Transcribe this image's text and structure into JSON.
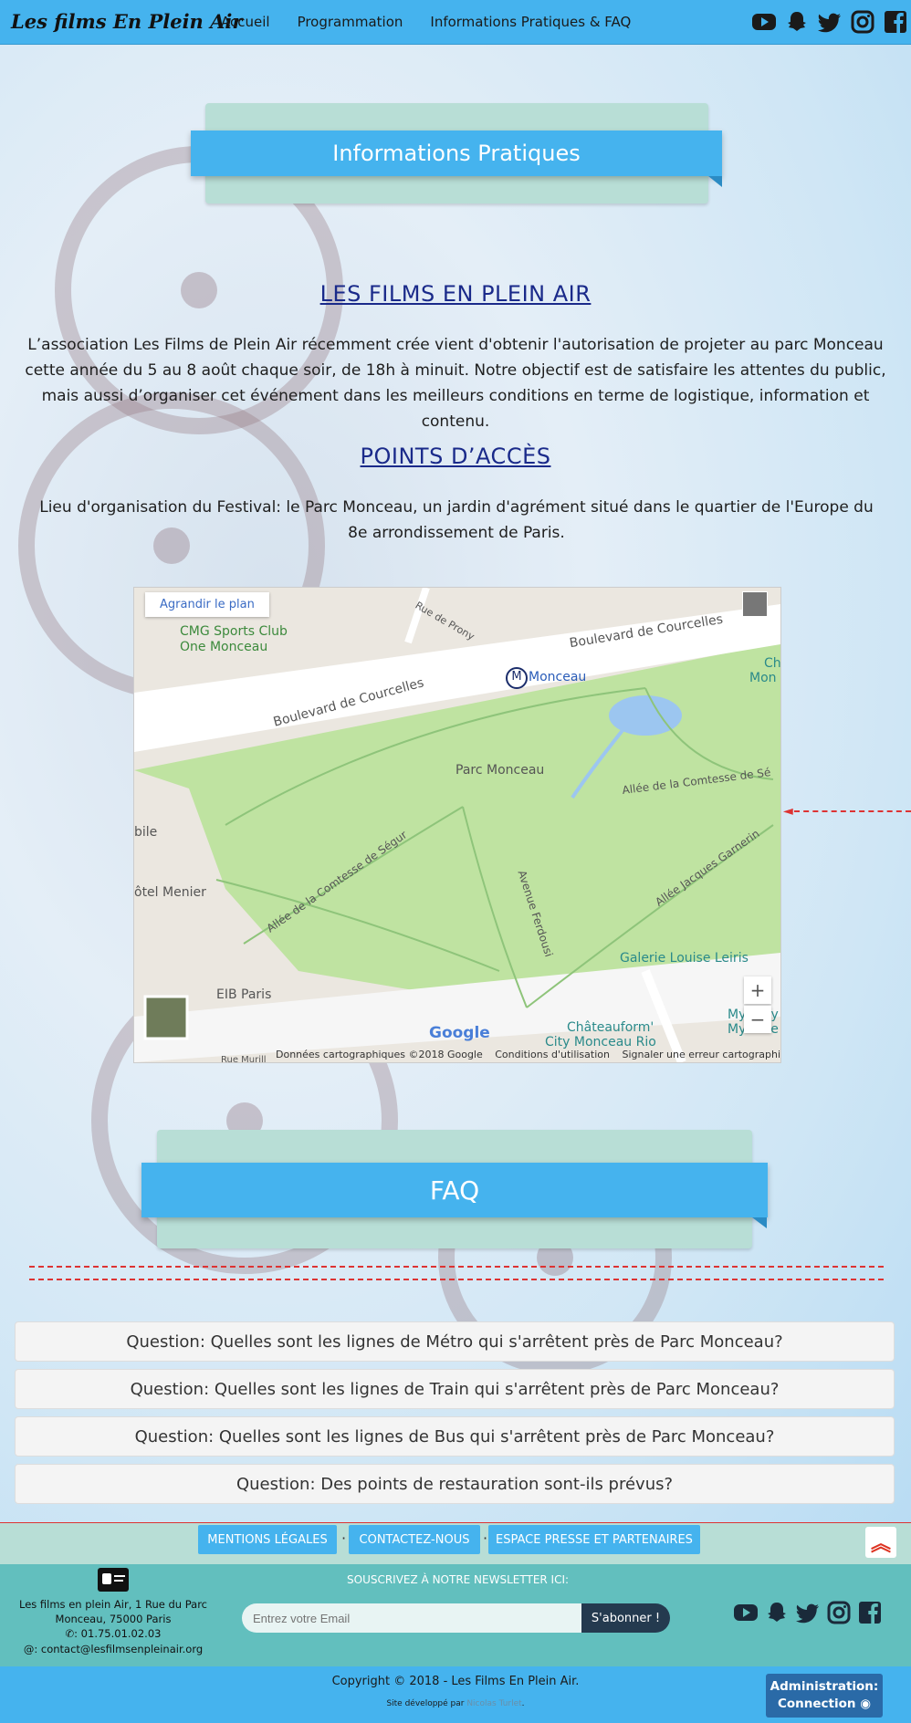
{
  "nav": {
    "brand": "Les films En Plein Air",
    "links": [
      "Accueil",
      "Programmation",
      "Informations Pratiques & FAQ"
    ],
    "social": [
      "youtube-icon",
      "snapchat-icon",
      "twitter-icon",
      "instagram-icon",
      "facebook-icon"
    ]
  },
  "info_banner": "Informations Pratiques",
  "section1": {
    "title": "LES FILMS EN PLEIN AIR",
    "text": "L’association Les Films de Plein Air récemment crée vient d'obtenir l'autorisation de projeter au parc Monceau cette année du 5 au 8 août chaque soir, de 18h à minuit. Notre objectif est de satisfaire les attentes du public, mais aussi d’organiser cet événement dans les meilleurs conditions en terme de logistique, information et contenu."
  },
  "section2": {
    "title": "POINTS D’ACCÈS",
    "text": "Lieu d'organisation du Festival: le Parc Monceau, un jardin d'agrément situé dans le quartier de l'Europe du 8e arrondissement de Paris."
  },
  "map": {
    "enlarge": "Agrandir le plan",
    "labels": {
      "cmg": "CMG Sports Club",
      "cmg2": "One Monceau",
      "prony": "Rue de Prony",
      "courcelles1": "Boulevard de Courcelles",
      "courcelles2": "Boulevard de Courcelles",
      "monceau": "Monceau",
      "parc": "Parc Monceau",
      "comtesse1": "Allée de la Comtesse de Sé",
      "comtesse2": "Allée de la Comtesse de Ségur",
      "bile": "bile",
      "menier": "ôtel Menier",
      "ferdousi": "Avenue Ferdousi",
      "garnerin": "Allée Jacques Garnerin",
      "galerie": "Galerie Louise Leiris",
      "eib": "EIB Paris",
      "chateau": "Châteauform'",
      "chateau2": "City Monceau Rio",
      "mystery": "Mystery",
      "mystery2": "Mystère",
      "ch": "Ch",
      "mon": "Mon",
      "google": "Google",
      "murill": "Rue Murill"
    },
    "footer": [
      "Données cartographiques ©2018 Google",
      "Conditions d'utilisation",
      "Signaler une erreur cartographique"
    ],
    "zoom_in": "+",
    "zoom_out": "−"
  },
  "faq_banner": "FAQ",
  "faq": [
    "Question: Quelles sont les lignes de Métro qui s'arrêtent près de Parc Monceau?",
    "Question: Quelles sont les lignes de Train qui s'arrêtent près de Parc Monceau?",
    "Question: Quelles sont les lignes de Bus qui s'arrêtent près de Parc Monceau?",
    "Question: Des points de restauration sont-ils prévus?"
  ],
  "footer": {
    "links": [
      "MENTIONS LÉGALES",
      "CONTACTEZ-NOUS",
      "ESPACE PRESSE ET PARTENAIRES"
    ],
    "sep": "·",
    "up_symbol": "︽",
    "address1": "Les films en plein Air, 1 Rue du Parc",
    "address2": "Monceau, 75000 Paris",
    "phone": ": 01.75.01.02.03",
    "email": ": contact@lesfilmsenpleinair.org",
    "newsletter": "SOUSCRIVEZ À NOTRE NEWSLETTER ICI:",
    "email_placeholder": "Entrez votre Email",
    "subscribe": "S'abonner !",
    "copyright": "Copyright © 2018 - Les Films En Plein Air.",
    "dev_prefix": "Site développé par ",
    "dev_name": "Nicolas Turlet",
    "dev_suffix": ".",
    "admin1": "Administration:",
    "admin2": "Connection"
  },
  "colors": {
    "accent": "#45b3ee",
    "teal": "#62bfbe",
    "mint": "#b8ded6",
    "dark": "#243a4f"
  }
}
